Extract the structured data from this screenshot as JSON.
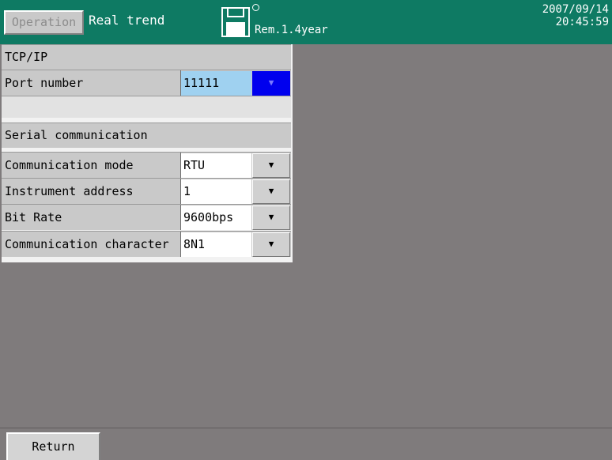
{
  "header": {
    "operation_label": "Operation",
    "title": "Real trend",
    "remaining": "Rem.1.4year",
    "date": "2007/09/14",
    "time": "20:45:59",
    "bg_color": "#0e7a63"
  },
  "tcpip": {
    "section_title": "TCP/IP",
    "port_label": "Port number",
    "port_value": "11111"
  },
  "serial": {
    "section_title": "Serial communication",
    "rows": [
      {
        "label": "Communication mode",
        "value": "RTU"
      },
      {
        "label": "Instrument address",
        "value": "1"
      },
      {
        "label": "Bit Rate",
        "value": "9600bps"
      },
      {
        "label": "Communication character",
        "value": "8N1"
      }
    ]
  },
  "dropdown_glyph": "▼",
  "footer": {
    "return_label": "Return"
  },
  "icons": [
    "floppy-disk-icon",
    "status-led-icon",
    "dropdown-arrow-icon"
  ]
}
